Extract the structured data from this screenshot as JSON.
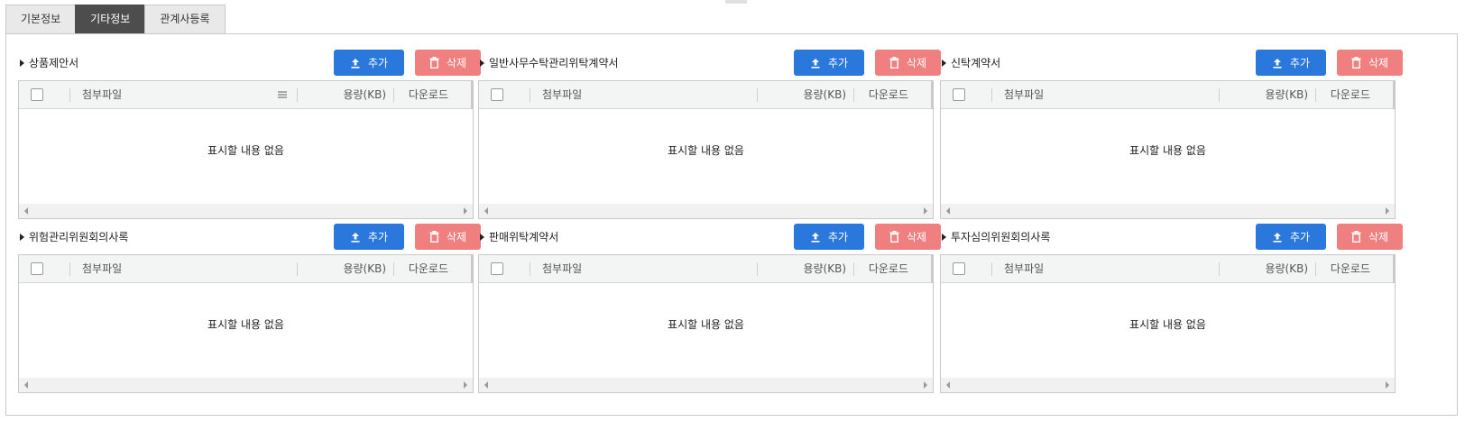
{
  "tabs": [
    {
      "label": "기본정보",
      "active": false
    },
    {
      "label": "기타정보",
      "active": true
    },
    {
      "label": "관계사등록",
      "active": false
    }
  ],
  "buttons": {
    "add_label": "추가",
    "delete_label": "삭제"
  },
  "grid": {
    "columns": {
      "file": "첨부파일",
      "size": "용량(KB)",
      "download": "다운로드"
    },
    "empty_text": "표시할 내용 없음"
  },
  "panels": [
    {
      "title": "상품제안서"
    },
    {
      "title": "일반사무수탁관리위탁계약서"
    },
    {
      "title": "신탁계약서"
    },
    {
      "title": "위험관리위원회의사록"
    },
    {
      "title": "판매위탁계약서"
    },
    {
      "title": "투자심의위원회의사록"
    }
  ],
  "icons": {
    "add": "upload-icon",
    "delete": "trash-icon",
    "column_menu": "column-menu-icon"
  },
  "colors": {
    "add_button": "#2b78dc",
    "delete_button": "#f08080",
    "active_tab": "#4d4d4d"
  }
}
